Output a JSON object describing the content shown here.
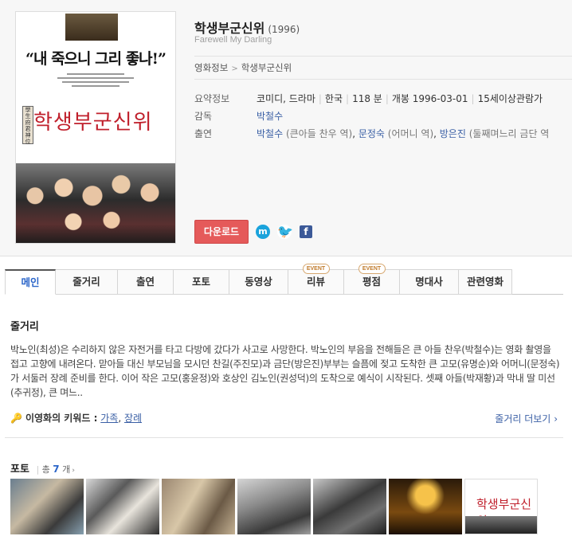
{
  "poster": {
    "quote": "“내 죽으니 그리 좋나!”",
    "title": "학생부군신위",
    "seal": "學生府君神位"
  },
  "movie": {
    "title": "학생부군신위",
    "year": "(1996)",
    "english_title": "Farewell My Darling"
  },
  "breadcrumb": {
    "parent": "영화정보",
    "separator": ">",
    "current": "학생부군신위"
  },
  "info": {
    "summary_label": "요약정보",
    "genre": "코미디, 드라마",
    "country": "한국",
    "runtime": "118 분",
    "release": "개봉 1996-03-01",
    "rating": "15세이상관람가",
    "director_label": "감독",
    "director": "박철수",
    "cast_label": "출연",
    "cast": [
      {
        "name": "박철수",
        "role": "(큰아들 찬우 역)"
      },
      {
        "name": "문정숙",
        "role": "(어머니 역)"
      },
      {
        "name": "방은진",
        "role": "(둘째며느리 금단 역"
      }
    ]
  },
  "actions": {
    "download": "다운로드",
    "share_icons": [
      "me2day-icon",
      "twitter-icon",
      "facebook-icon"
    ]
  },
  "tabs": [
    {
      "label": "메인",
      "active": true,
      "badge": ""
    },
    {
      "label": "줄거리",
      "active": false,
      "badge": ""
    },
    {
      "label": "출연",
      "active": false,
      "badge": ""
    },
    {
      "label": "포토",
      "active": false,
      "badge": ""
    },
    {
      "label": "동영상",
      "active": false,
      "badge": ""
    },
    {
      "label": "리뷰",
      "active": false,
      "badge": "EVENT"
    },
    {
      "label": "평점",
      "active": false,
      "badge": "EVENT"
    },
    {
      "label": "명대사",
      "active": false,
      "badge": ""
    },
    {
      "label": "관련영화",
      "active": false,
      "badge": ""
    }
  ],
  "synopsis": {
    "heading": "줄거리",
    "text": "박노인(최성)은 수리하지 않은 자전거를 타고 다방에 갔다가 사고로 사망한다. 박노인의 부음을 전해들은 큰 아들 찬우(박철수)는 영화 촬영을 접고 고향에 내려온다. 맏아들 대신 부모님을 모시던 찬길(주진모)과 금단(방은진)부부는 슬픔에 젖고 도착한 큰 고모(유명순)와 어머니(문정숙)가 서둘러 장례 준비를 한다. 이어 작은 고모(홍윤정)와 호상인 김노인(권성덕)의 도착으로 예식이 시작된다. 셋째 아들(박재황)과 막내 딸 미선(추귀정), 큰 며느..",
    "keyword_label": "이영화의 키워드 :",
    "keywords": [
      "가족",
      "장례"
    ],
    "more": "줄거리 더보기"
  },
  "photos": {
    "heading": "포토",
    "count_prefix": "총",
    "count": "7",
    "count_suffix": "개",
    "thumb_text": "학생부군신위"
  }
}
